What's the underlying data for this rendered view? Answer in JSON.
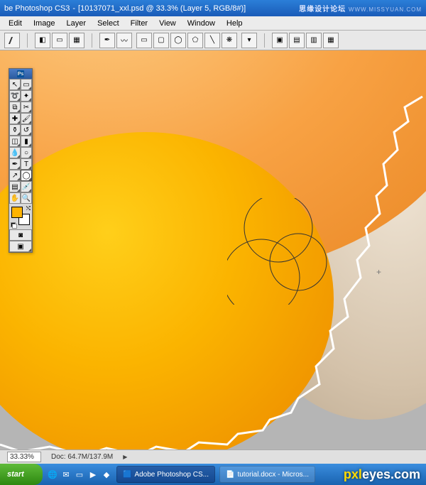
{
  "titlebar": {
    "app": "be Photoshop CS3",
    "doc": "[10137071_xxl.psd @ 33.3% (Layer 5, RGB/8#)]"
  },
  "menu": {
    "edit": "Edit",
    "image": "Image",
    "layer": "Layer",
    "select": "Select",
    "filter": "Filter",
    "view": "View",
    "window": "Window",
    "help": "Help"
  },
  "status": {
    "zoom": "33.33%",
    "doc": "Doc: 64.7M/137.9M"
  },
  "taskbar": {
    "start": "start",
    "app": "Adobe Photoshop CS...",
    "doc": "tutorial.docx - Micros..."
  },
  "watermark1": {
    "main": "思缘设计论坛",
    "url": "WWW.MISSYUAN.COM"
  },
  "watermark2": {
    "pxl": "pxl",
    "rest": "eyes.com"
  },
  "ps": "Ps",
  "colors": {
    "fg": "#ffb400",
    "bg": "#ffffff"
  }
}
